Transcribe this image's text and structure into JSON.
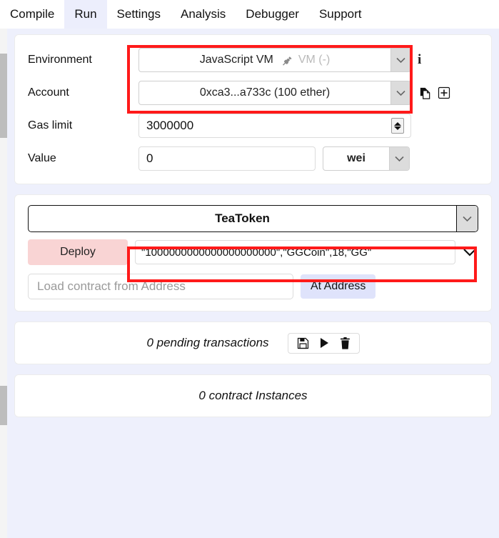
{
  "tabs": [
    {
      "label": "Compile",
      "active": false
    },
    {
      "label": "Run",
      "active": true
    },
    {
      "label": "Settings",
      "active": false
    },
    {
      "label": "Analysis",
      "active": false
    },
    {
      "label": "Debugger",
      "active": false
    },
    {
      "label": "Support",
      "active": false
    }
  ],
  "settings": {
    "environment": {
      "label": "Environment",
      "value": "JavaScript VM",
      "plug_icon": "plug-icon",
      "connection_status": "VM (-)",
      "info_icon": "info-icon",
      "caret": "⌄"
    },
    "account": {
      "label": "Account",
      "value": "0xca3...a733c (100 ether)",
      "copy_icon": "copy-icon",
      "add_icon": "plus-square-icon",
      "caret": "⌄"
    },
    "gas_limit": {
      "label": "Gas limit",
      "value": "3000000",
      "stepper_icon": "spinner-icon"
    },
    "value": {
      "label": "Value",
      "value": "0",
      "unit": "wei",
      "caret": "⌄"
    }
  },
  "contract": {
    "selected": "TeaToken",
    "caret": "⌄",
    "deploy_label": "Deploy",
    "constructor_args": "\"1000000000000000000000\",\"GGCoin\",18,\"GG\"",
    "args_caret": "⌄",
    "address_placeholder": "Load contract from Address",
    "address_value": "",
    "at_address_label": "At Address"
  },
  "pending": {
    "text": "0 pending transactions",
    "save_icon": "save-icon",
    "play_icon": "play-icon",
    "trash_icon": "trash-icon"
  },
  "instances": {
    "text": "0 contract Instances"
  },
  "colors": {
    "page_bg": "#eef0fc",
    "active_tab_bg": "#eceefc",
    "deploy_bg": "#f9d4d4",
    "at_address_bg": "#dfe3fb",
    "annotation": "#ff1a1a"
  }
}
